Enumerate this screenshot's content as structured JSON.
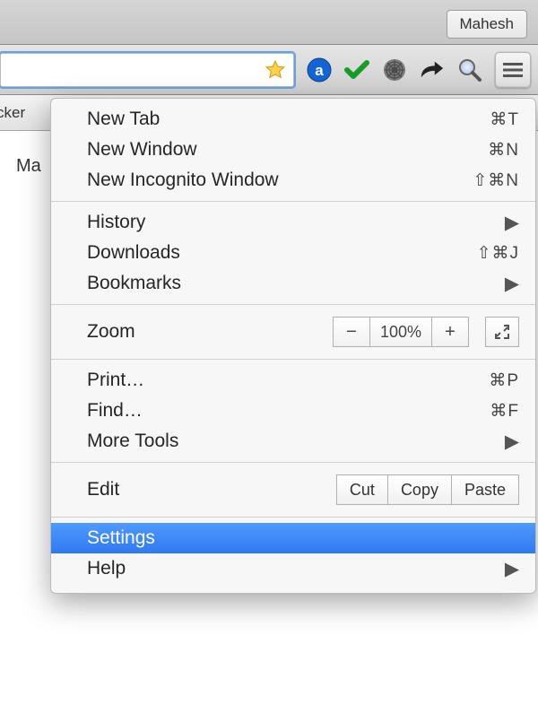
{
  "titlebar": {
    "user_label": "Mahesh"
  },
  "toolbar": {
    "icons": {
      "star": "bookmark-star-icon",
      "amazon": "amazon-assistant-icon",
      "check": "green-check-icon",
      "spider": "web-spider-icon",
      "share": "share-arrow-icon",
      "search": "magnifier-icon",
      "menu": "hamburger-menu-icon"
    }
  },
  "bookmarksbar": {
    "partial_label": "cker"
  },
  "page": {
    "partial_text": "Ma"
  },
  "menu": {
    "new_tab": "New Tab",
    "new_tab_sc": "⌘T",
    "new_window": "New Window",
    "new_window_sc": "⌘N",
    "new_incognito": "New Incognito Window",
    "new_incognito_sc": "⇧⌘N",
    "history": "History",
    "downloads": "Downloads",
    "downloads_sc": "⇧⌘J",
    "bookmarks": "Bookmarks",
    "zoom_label": "Zoom",
    "zoom_value": "100%",
    "print": "Print…",
    "print_sc": "⌘P",
    "find": "Find…",
    "find_sc": "⌘F",
    "more_tools": "More Tools",
    "edit_label": "Edit",
    "edit_cut": "Cut",
    "edit_copy": "Copy",
    "edit_paste": "Paste",
    "settings": "Settings",
    "help": "Help"
  }
}
